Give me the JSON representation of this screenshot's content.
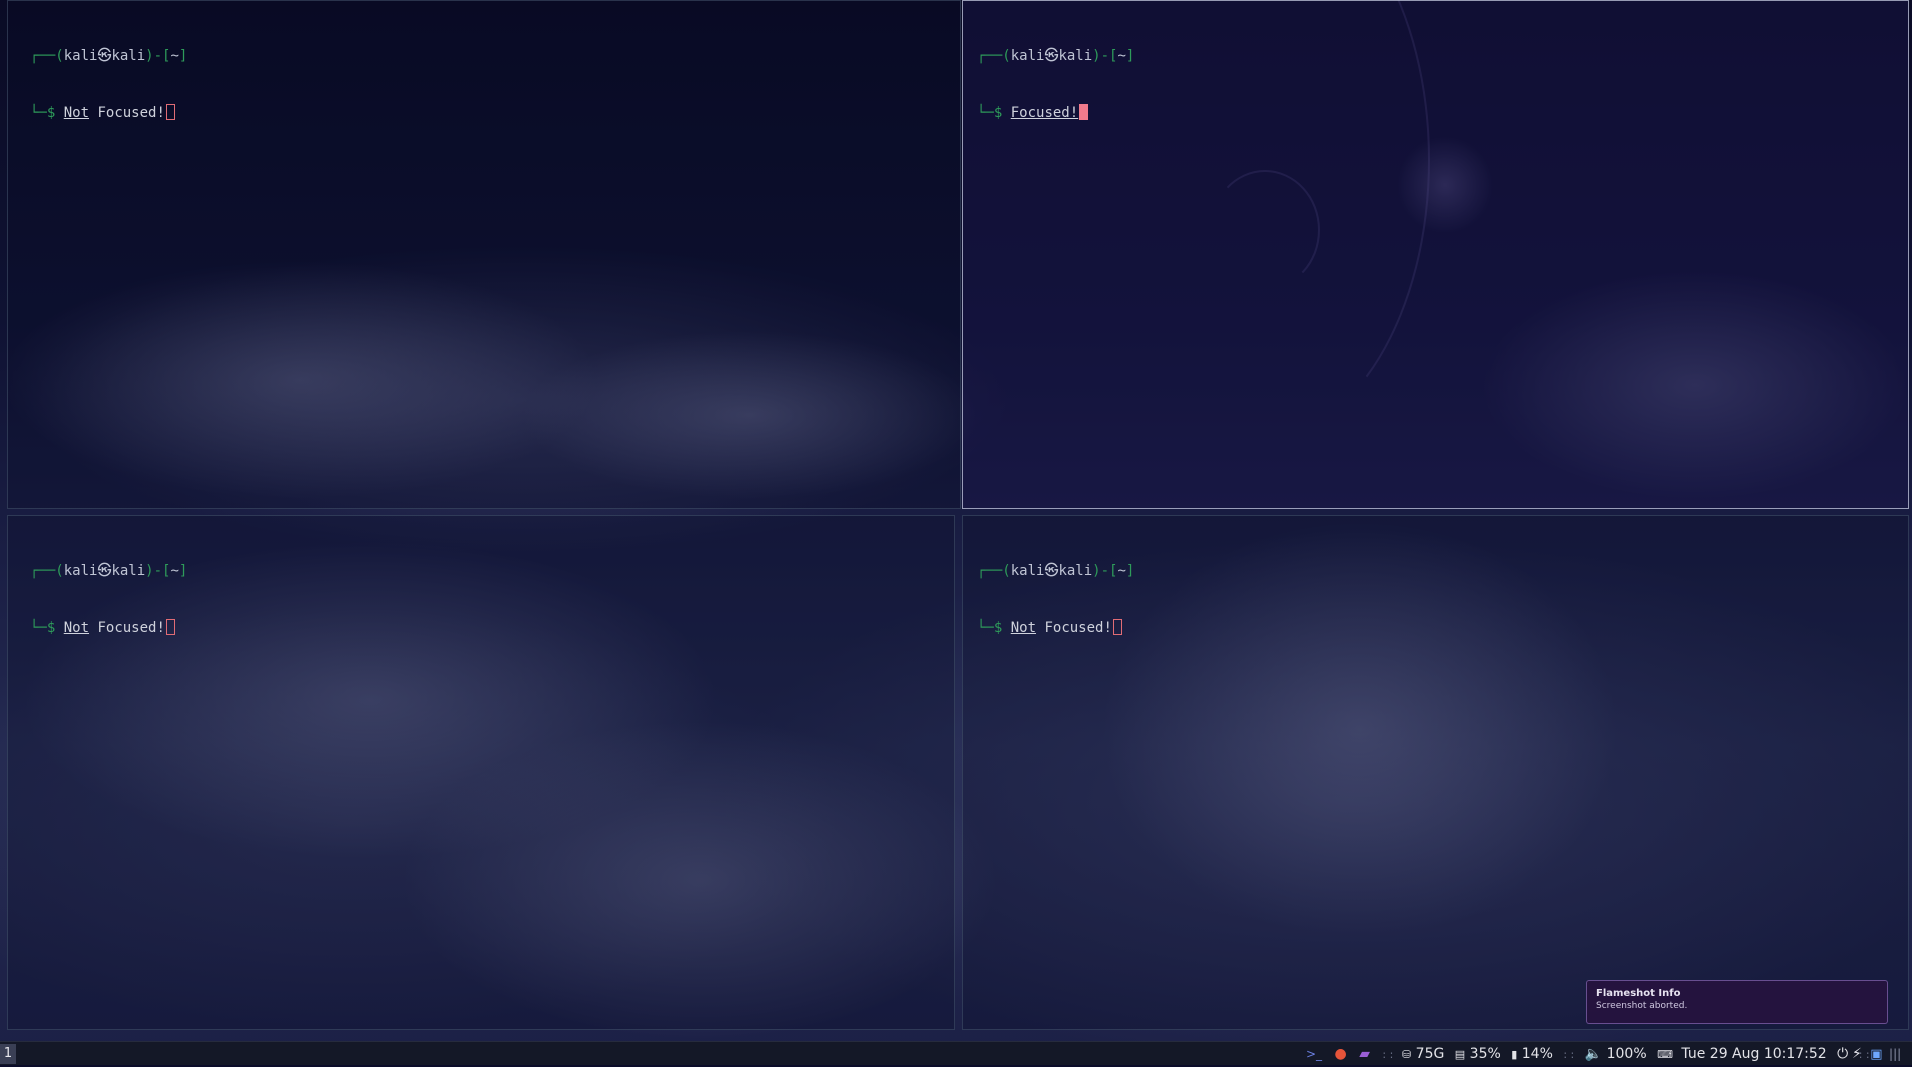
{
  "terminals": [
    {
      "user": "kali",
      "host": "kali",
      "dir": "~",
      "words": [
        "Not",
        "Focused!"
      ],
      "focused": false
    },
    {
      "user": "kali",
      "host": "kali",
      "dir": "~",
      "words": [
        "Focused!"
      ],
      "focused": true
    },
    {
      "user": "kali",
      "host": "kali",
      "dir": "~",
      "words": [
        "Not",
        "Focused!"
      ],
      "focused": false
    },
    {
      "user": "kali",
      "host": "kali",
      "dir": "~",
      "words": [
        "Not",
        "Focused!"
      ],
      "focused": false
    }
  ],
  "prompt": {
    "at_symbol": "㉿",
    "dollar": "$"
  },
  "taskbar": {
    "workspace": "1",
    "disk": "75G",
    "memory": "35%",
    "battery": "14%",
    "volume": "100%",
    "datetime": "Tue 29 Aug 10:17:52"
  },
  "notification": {
    "title": "Flameshot Info",
    "body": "Screenshot aborted."
  },
  "colors": {
    "prompt_green": "#2e9b5a",
    "cursor": "#f07a8c",
    "taskbar_bg": "#141827"
  }
}
